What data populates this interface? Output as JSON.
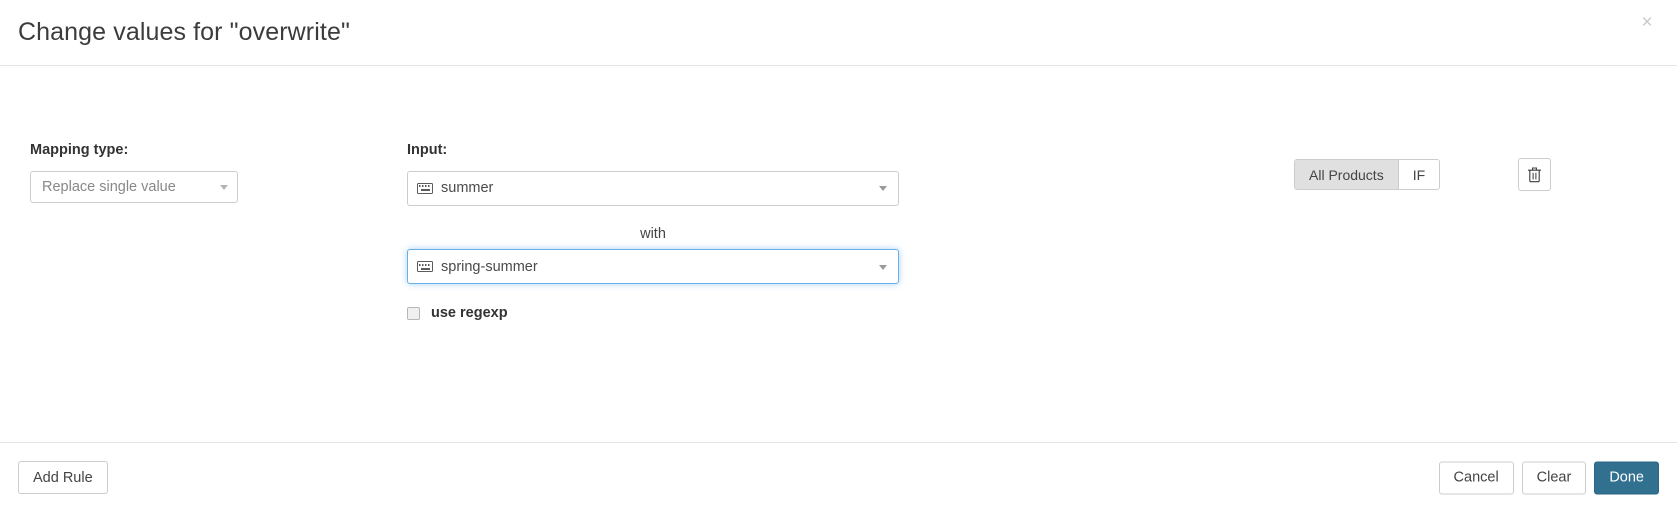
{
  "dialog": {
    "title": "Change values for \"overwrite\"",
    "close_label": "×"
  },
  "mapping": {
    "label": "Mapping type:",
    "selected": "Replace single value",
    "options": [
      "Replace single value"
    ]
  },
  "input": {
    "label": "Input:",
    "source_value": "summer",
    "source_icon": "keyboard-icon",
    "with_label": "with",
    "target_value": "spring-summer",
    "target_icon": "keyboard-icon",
    "regexp_label": "use regexp",
    "regexp_checked": false
  },
  "scope": {
    "buttons": [
      {
        "label": "All Products",
        "active": true
      },
      {
        "label": "IF",
        "active": false
      }
    ],
    "delete_icon": "trash-icon"
  },
  "footer": {
    "add_rule_label": "Add Rule",
    "cancel_label": "Cancel",
    "clear_label": "Clear",
    "done_label": "Done"
  },
  "colors": {
    "primary": "#31708f",
    "focus_border": "#66afe9",
    "active_toggle": "#e0e0e0",
    "border": "#cccccc"
  }
}
